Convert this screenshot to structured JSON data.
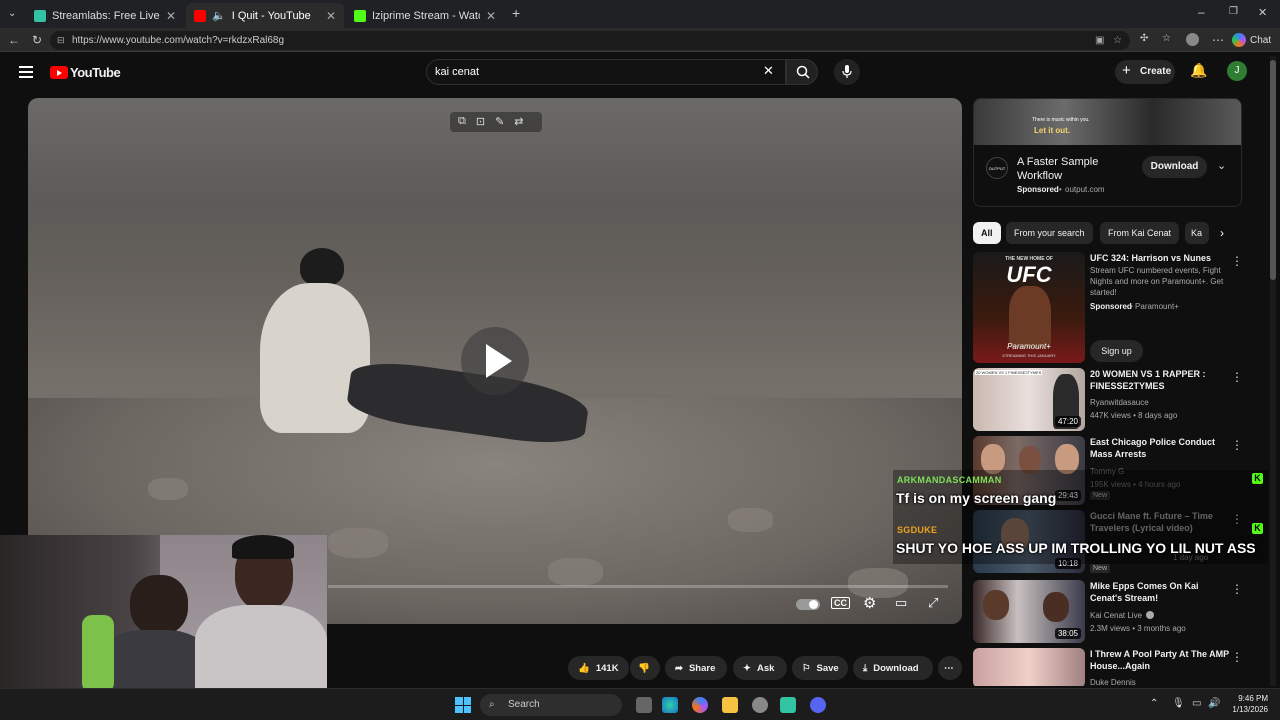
{
  "browser": {
    "tabs": [
      {
        "label": "Streamlabs: Free Live Streaming &",
        "favicon_color": "#31c3a2"
      },
      {
        "label": "I Quit - YouTube",
        "favicon_color": "#ff0000"
      },
      {
        "label": "Iziprime Stream - Watch Live on K",
        "favicon_color": "#53fc18"
      }
    ],
    "url": "https://www.youtube.com/watch?v=rkdzxRal68g",
    "chat_label": "Chat"
  },
  "youtube": {
    "logo_text": "YouTube",
    "search_value": "kai cenat",
    "create_label": "Create",
    "avatar_letter": "J",
    "actions": {
      "like_count": "141K",
      "share": "Share",
      "ask": "Ask",
      "save": "Save",
      "download": "Download"
    }
  },
  "ad": {
    "banner_text_1": "There is music within you.",
    "banner_text_2": "Let it out.",
    "title": "A Faster Sample Workflow",
    "sponsored": "Sponsored",
    "domain": "output.com",
    "button": "Download",
    "logo_text": "OUTPUT"
  },
  "chips": [
    "All",
    "From your search",
    "From Kai Cenat",
    "Ka"
  ],
  "recommendations": [
    {
      "title": "UFC 324: Harrison vs Nunes",
      "desc": "Stream UFC numbered events, Fight Nights and more on Paramount+. Get started!",
      "sponsored": "Sponsored",
      "channel": "Paramount+",
      "button": "Sign up",
      "thumb_text_1": "THE NEW HOME OF",
      "thumb_text_2": "UFC",
      "thumb_text_3": "Paramount+",
      "thumb_text_4": "STREAMING THIS JANUARY"
    },
    {
      "title": "20 WOMEN VS 1 RAPPER : FINESSE2TYMES",
      "channel": "Ryanwitdasauce",
      "stats": "447K views • 8 days ago",
      "duration": "47:20",
      "thumb_text": "20 WOMEN VS 1 FINESSE2TYMES"
    },
    {
      "title": "East Chicago Police Conduct Mass Arrests",
      "channel": "Tommy G",
      "stats": "195K views • 4 hours ago",
      "badge": "New",
      "duration": "29:43"
    },
    {
      "title": "Gucci Mane ft. Future – Time Travelers (Lyrical video)",
      "stats": "1 day ago",
      "badge": "New",
      "duration": "10:18"
    },
    {
      "title": "Mike Epps Comes On Kai Cenat's Stream!",
      "channel": "Kai Cenat Live",
      "stats": "2.3M views • 3 months ago",
      "duration": "38:05"
    },
    {
      "title": "I Threw A Pool Party At The AMP House...Again",
      "channel": "Duke Dennis"
    }
  ],
  "chat": [
    {
      "user": "ARKMANDASCAMMAN",
      "message": "Tf is on my screen gang",
      "color": "#7fe05a"
    },
    {
      "user": "SGDUKE",
      "message": "SHUT YO HOE ASS UP IM TROLLING YO LIL NUT ASS",
      "color": "#f0a020"
    }
  ],
  "taskbar": {
    "search": "Search",
    "time": "9:46 PM",
    "date": "1/13/2026"
  }
}
